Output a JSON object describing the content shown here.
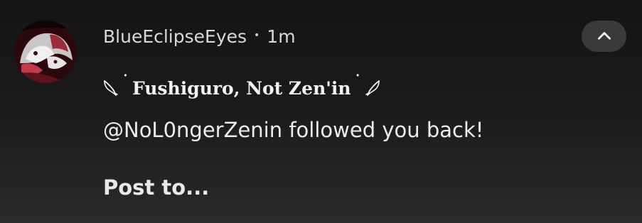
{
  "notification": {
    "app_name": "BlueEclipseEyes",
    "separator": "•",
    "time": "1m",
    "title": "Fushiguro, Not Zen'in",
    "title_dot_left": "˙",
    "title_dot_right": "˙",
    "message": "@NoL0ngerZenin followed you back!",
    "action_label": "Post to...",
    "collapse_icon": "chevron-up-icon",
    "avatar_icon": "profile-avatar"
  }
}
